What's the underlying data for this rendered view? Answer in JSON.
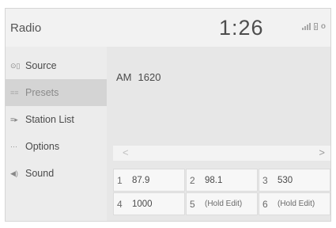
{
  "header": {
    "title": "Radio",
    "clock": "1:26"
  },
  "sidebar": {
    "items": [
      {
        "label": "Source",
        "icon": "source-icon",
        "glyph": "⊙▯"
      },
      {
        "label": "Presets",
        "icon": "presets-icon",
        "glyph": "≡≡",
        "active": true
      },
      {
        "label": "Station List",
        "icon": "station-list-icon",
        "glyph": "≡▸"
      },
      {
        "label": "Options",
        "icon": "options-icon",
        "glyph": "···"
      },
      {
        "label": "Sound",
        "icon": "sound-icon",
        "glyph": "◀)"
      }
    ]
  },
  "main": {
    "band": "AM",
    "frequency": "1620",
    "nav": {
      "prev": "<",
      "next": ">"
    },
    "presets": [
      {
        "number": "1",
        "value": "87.9"
      },
      {
        "number": "2",
        "value": "98.1"
      },
      {
        "number": "3",
        "value": "530"
      },
      {
        "number": "4",
        "value": "1000"
      },
      {
        "number": "5",
        "value": "(Hold Edit)"
      },
      {
        "number": "6",
        "value": "(Hold Edit)"
      }
    ]
  },
  "colors": {
    "background": "#ececec",
    "active_item": "#d4d4d4",
    "preset_button": "#f7f7f7"
  }
}
